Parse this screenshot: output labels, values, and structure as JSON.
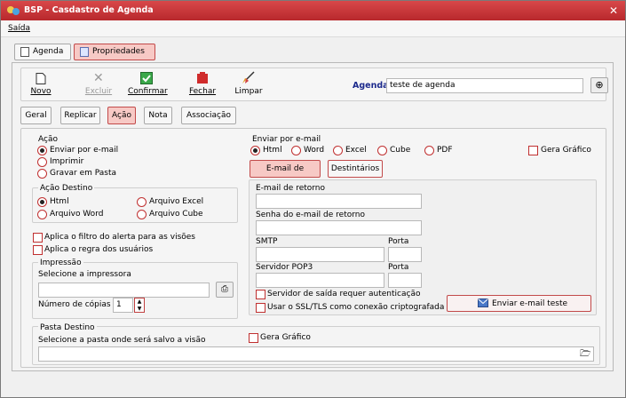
{
  "window": {
    "title": "BSP - Casdastro de Agenda"
  },
  "menu": {
    "saida": "Saída"
  },
  "top_tabs": [
    {
      "label": "Agenda"
    },
    {
      "label": "Propriedades"
    }
  ],
  "toolbar": {
    "novo": "Novo",
    "excluir": "Excluir",
    "confirmar": "Confirmar",
    "fechar": "Fechar",
    "limpar": "Limpar",
    "agenda_label": "Agenda",
    "agenda_value": "teste de agenda"
  },
  "sub_tabs": [
    {
      "label": "Geral"
    },
    {
      "label": "Replicar"
    },
    {
      "label": "Ação"
    },
    {
      "label": "Nota"
    },
    {
      "label": "Associação"
    }
  ],
  "acao": {
    "title": "Ação",
    "options": [
      {
        "label": "Enviar por e-mail"
      },
      {
        "label": "Imprimir"
      },
      {
        "label": "Gravar em Pasta"
      }
    ]
  },
  "acao_destino": {
    "title": "Ação Destino",
    "options": [
      {
        "label": "Html"
      },
      {
        "label": "Arquivo Excel"
      },
      {
        "label": "Arquivo Word"
      },
      {
        "label": "Arquivo Cube"
      }
    ]
  },
  "checks": {
    "filtro": "Aplica o filtro do alerta para as visões",
    "regra": "Aplica o regra dos usuários"
  },
  "impressao": {
    "title": "Impressão",
    "select_label": "Selecione a impressora",
    "copias_label": "Número de cópias",
    "copias_value": "1"
  },
  "enviar": {
    "title": "Enviar por e-mail",
    "formats": [
      {
        "label": "Html"
      },
      {
        "label": "Word"
      },
      {
        "label": "Excel"
      },
      {
        "label": "Cube"
      },
      {
        "label": "PDF"
      }
    ],
    "gera_grafico": "Gera Gráfico",
    "btn_retorno": "E-mail de retorno",
    "btn_destinatarios": "Destintários",
    "email_retorno_label": "E-mail de retorno",
    "senha_label": "Senha do e-mail de retorno",
    "smtp_label": "SMTP",
    "porta_label": "Porta",
    "pop3_label": "Servidor POP3",
    "porta2_label": "Porta",
    "auth_check": "Servidor de saída requer autenticação",
    "ssl_check": "Usar o SSL/TLS como conexão criptografada",
    "teste_button": "Enviar e-mail teste"
  },
  "pasta": {
    "title": "Pasta Destino",
    "select_label": "Selecione a pasta onde será salvo a visão",
    "gera_grafico": "Gera Gráfico"
  }
}
